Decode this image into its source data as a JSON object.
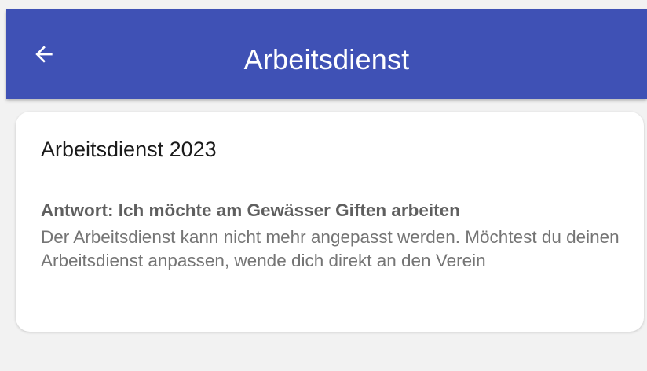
{
  "app_bar": {
    "title": "Arbeitsdienst",
    "back_icon": "arrow-left-icon",
    "color": "#3f51b5"
  },
  "card": {
    "title": "Arbeitsdienst 2023",
    "answer": "Antwort: Ich möchte am Gewässer Giften arbeiten",
    "info": "Der Arbeitsdienst kann nicht mehr angepasst werden. Möchtest du deinen Arbeitsdienst anpassen, wende dich direkt an den Verein"
  }
}
